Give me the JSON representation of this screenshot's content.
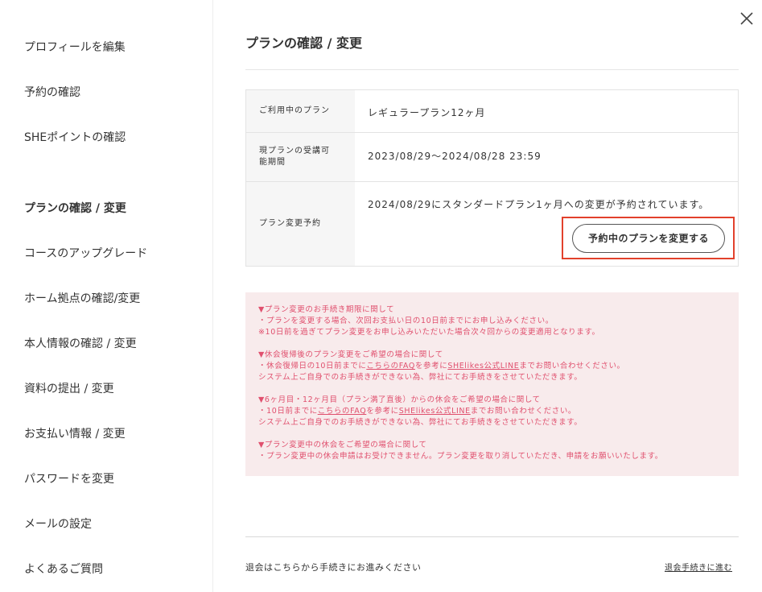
{
  "sidebar": {
    "items": [
      {
        "label": "プロフィールを編集",
        "active": false
      },
      {
        "label": "予約の確認",
        "active": false
      },
      {
        "label": "SHEポイントの確認",
        "active": false
      },
      {
        "label": "プランの確認 / 変更",
        "active": true
      },
      {
        "label": "コースのアップグレード",
        "active": false
      },
      {
        "label": "ホーム拠点の確認/変更",
        "active": false
      },
      {
        "label": "本人情報の確認 / 変更",
        "active": false
      },
      {
        "label": "資料の提出 / 変更",
        "active": false
      },
      {
        "label": "お支払い情報 / 変更",
        "active": false
      },
      {
        "label": "パスワードを変更",
        "active": false
      },
      {
        "label": "メールの設定",
        "active": false
      },
      {
        "label": "よくあるご質問",
        "active": false
      }
    ]
  },
  "main": {
    "title": "プランの確認 / 変更",
    "close_icon": "close-icon",
    "plan_table": {
      "rows": [
        {
          "label": "ご利用中のプラン",
          "value": "レギュラープラン12ヶ月"
        },
        {
          "label_line1": "現プランの受講可",
          "label_line2": "能期間",
          "value": "2023/08/29〜2024/08/28 23:59"
        },
        {
          "label": "プラン変更予約",
          "value": "2024/08/29にスタンダードプラン1ヶ月への変更が予約されています。"
        }
      ],
      "change_button_label": "予約中のプランを変更する",
      "highlight_color": "#e2412c"
    },
    "notice": {
      "color": "#e0506e",
      "background": "#f8ebec",
      "s1": {
        "title": "▼プラン変更のお手続き期限に関して",
        "l1": "・プランを変更する場合、次回お支払い日の10日前までにお申し込みください。",
        "l2": "※10日前を過ぎてプラン変更をお申し込みいただいた場合次々回からの変更適用となります。"
      },
      "s2": {
        "title": "▼休会復帰後のプラン変更をご希望の場合に関して",
        "l1_pre": "・休会復帰日の10日前までに",
        "l1_link1": "こちらのFAQ",
        "l1_mid": "を参考に",
        "l1_link2": "SHElikes公式LINE",
        "l1_post": "までお問い合わせください。",
        "l2": "システム上ご自身でのお手続きができない為、弊社にてお手続きをさせていただきます。"
      },
      "s3": {
        "title": "▼6ヶ月目・12ヶ月目（プラン満了直後）からの休会をご希望の場合に関して",
        "l1_pre": "・10日前までに",
        "l1_link1": "こちらのFAQ",
        "l1_mid": "を参考に",
        "l1_link2": "SHElikes公式LINE",
        "l1_post": "までお問い合わせください。",
        "l2": "システム上ご自身でのお手続きができない為、弊社にてお手続きをさせていただきます。"
      },
      "s4": {
        "title": "▼プラン変更中の休会をご希望の場合に関して",
        "l1": "・プラン変更中の休会申請はお受けできません。プラン変更を取り消していただき、申請をお願いいたします。"
      }
    },
    "footer": {
      "leave_text": "退会はこちらから手続きにお進みください",
      "leave_link": "退会手続きに進む"
    }
  }
}
